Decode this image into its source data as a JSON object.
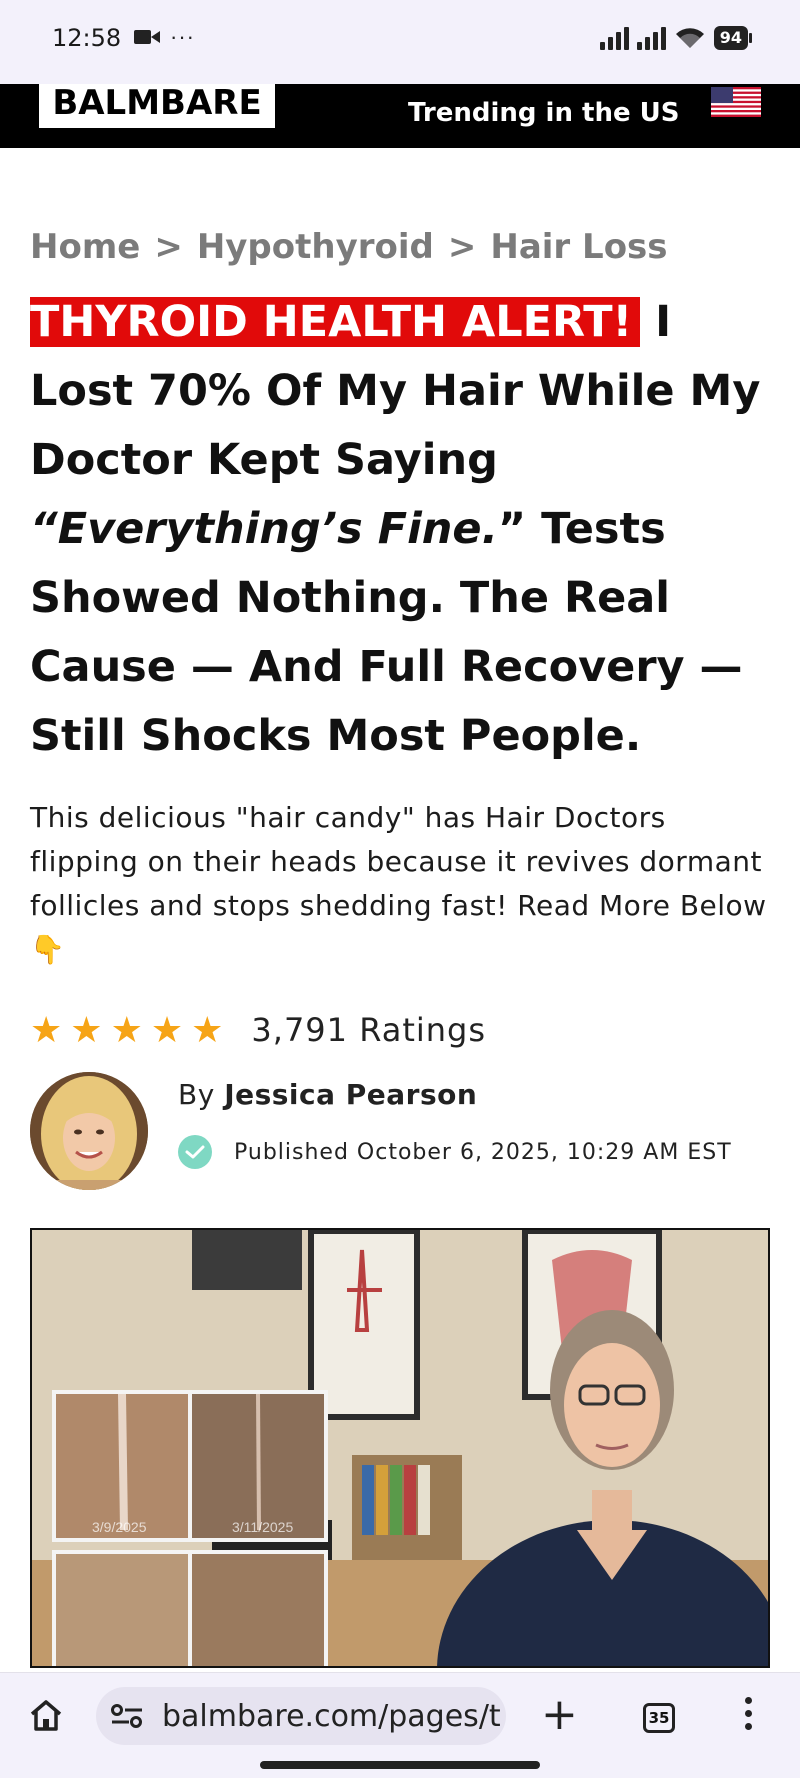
{
  "status_bar": {
    "time": "12:58",
    "left_icons": [
      "video-camera-icon",
      "more-dots-icon"
    ],
    "right_icons": [
      "cell-signal-icon",
      "cell-signal-icon",
      "wifi-icon"
    ],
    "battery": "94"
  },
  "site_header": {
    "logo": "BALMBARE",
    "trending": "Trending in the US",
    "flag_icon": "us-flag-icon"
  },
  "breadcrumb": {
    "items": [
      "Home",
      "Hypothyroid",
      "Hair Loss"
    ],
    "separator": ">"
  },
  "headline": {
    "alert": "THYROID HEALTH ALERT!",
    "part1": " I Lost 70% Of My Hair While My Doctor Kept Saying ",
    "quote": "“Everything’s Fine.",
    "part2": "” Tests Showed Nothing. The Real Cause — And Full Recovery — Still Shocks Most People."
  },
  "subtext": {
    "text": "This delicious \"hair candy\" has Hair Doctors flipping on their heads because it revives dormant follicles and stops shedding fast! Read More Below 👇"
  },
  "rating": {
    "stars": 5,
    "count_label": "3,791 Ratings"
  },
  "author": {
    "by": "By",
    "name": "Jessica Pearson",
    "published": "Published October 6, 2025, 10:29 AM EST"
  },
  "hero_image": {
    "date_left": "3/9/2025",
    "date_right": "3/11/2025"
  },
  "browser_bar": {
    "url": "balmbare.com/pages/th",
    "tab_count": "35"
  },
  "colors": {
    "alert_red": "#e10a0a",
    "star_gold": "#f6a416",
    "verify_teal": "#7fd8c3",
    "header_black": "#000000"
  }
}
